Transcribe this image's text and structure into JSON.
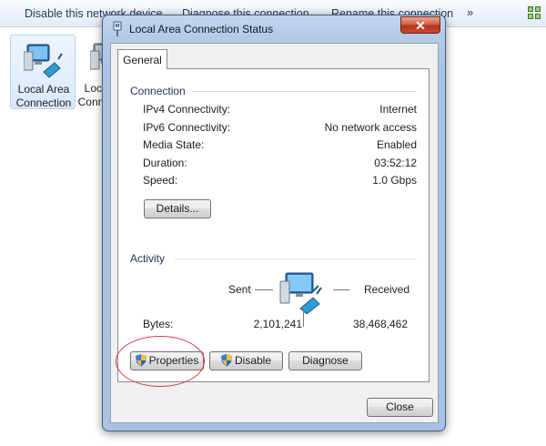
{
  "toolbar": {
    "items": [
      "Disable this network device",
      "Diagnose this connection",
      "Rename this connection"
    ],
    "more": "»"
  },
  "explorer": {
    "items": [
      {
        "label": "Local Area Connection",
        "selected": true
      },
      {
        "label": "Local Area Connection 2",
        "selected": false
      }
    ]
  },
  "dialog": {
    "title": "Local Area Connection Status",
    "close_glyph": "✕",
    "tab": "General",
    "connection": {
      "heading": "Connection",
      "rows": [
        {
          "label": "IPv4 Connectivity:",
          "value": "Internet"
        },
        {
          "label": "IPv6 Connectivity:",
          "value": "No network access"
        },
        {
          "label": "Media State:",
          "value": "Enabled"
        },
        {
          "label": "Duration:",
          "value": "03:52:12"
        },
        {
          "label": "Speed:",
          "value": "1.0 Gbps"
        }
      ],
      "details_button": "Details..."
    },
    "activity": {
      "heading": "Activity",
      "sent_label": "Sent",
      "received_label": "Received",
      "bytes_label": "Bytes:",
      "bytes_sent": "2,101,241",
      "bytes_received": "38,468,462"
    },
    "buttons": {
      "properties": "Properties",
      "disable": "Disable",
      "diagnose": "Diagnose",
      "close": "Close"
    }
  },
  "colors": {
    "highlight_circle": "#d23b3b",
    "window_frame": "#abc4e4",
    "close_button": "#c74a2e"
  },
  "icons": {
    "network_adapter": "network-computer-icon",
    "shield": "uac-shield-icon",
    "title": "network-plug-icon"
  }
}
